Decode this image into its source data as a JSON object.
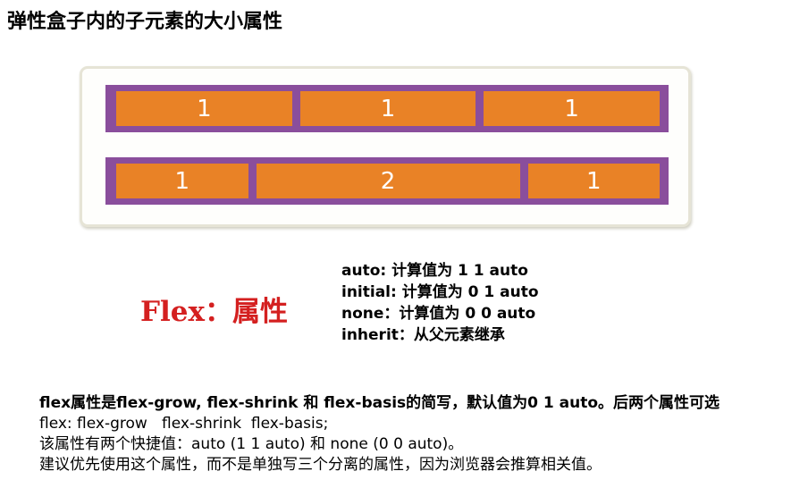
{
  "title": "弹性盒子内的子元素的大小属性",
  "demo": {
    "row1": [
      "1",
      "1",
      "1"
    ],
    "row2": [
      "1",
      "2",
      "1"
    ],
    "colors": {
      "container": "#8a4e9c",
      "item": "#e98226"
    }
  },
  "flex_label": "Flex：属性",
  "values": [
    "auto: 计算值为 1 1 auto",
    "initial: 计算值为 0 1 auto",
    "none：计算值为 0 0 auto",
    "inherit：从父元素继承"
  ],
  "notes": [
    "flex属性是flex-grow, flex-shrink 和 flex-basis的简写，默认值为0 1 auto。后两个属性可选",
    "flex: flex-grow   flex-shrink  flex-basis;",
    "该属性有两个快捷值：auto (1 1 auto) 和 none (0 0 auto)。",
    "建议优先使用这个属性，而不是单独写三个分离的属性，因为浏览器会推算相关值。"
  ]
}
